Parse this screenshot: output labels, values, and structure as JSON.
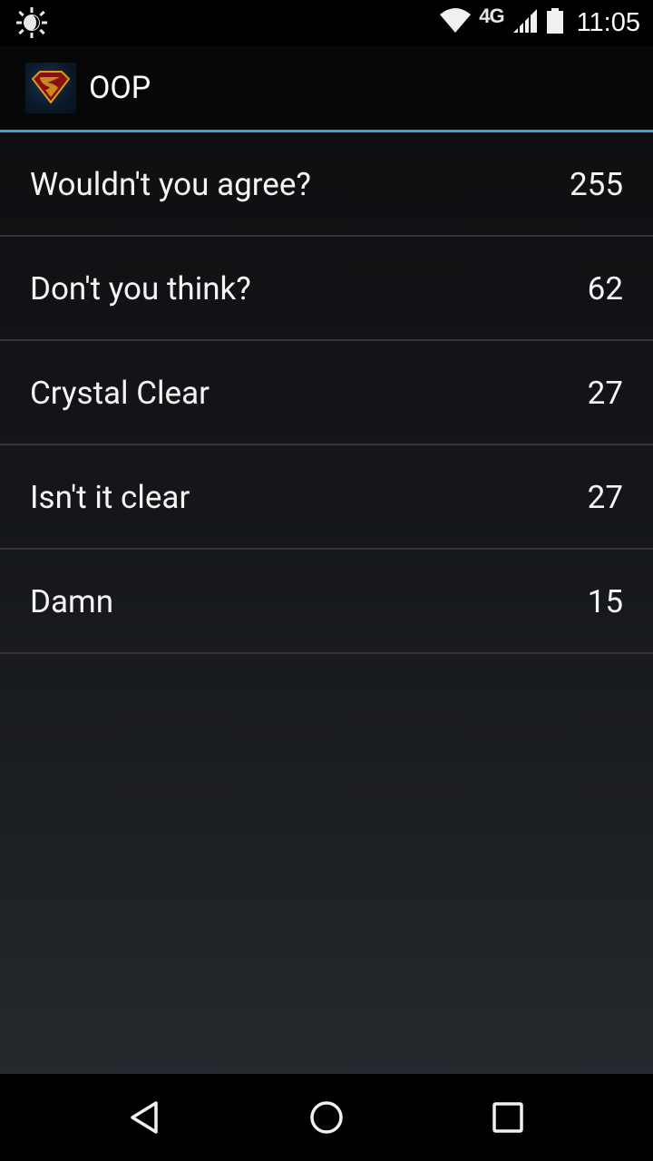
{
  "status_bar": {
    "network": "4G",
    "time": "11:05",
    "icons": [
      "brightness-icon",
      "wifi-icon",
      "signal-icon",
      "battery-icon"
    ]
  },
  "action_bar": {
    "title": "OOP",
    "icon": "superman-logo-icon",
    "accent_color": "#3c9fd2"
  },
  "list": {
    "items": [
      {
        "label": "Wouldn't you agree?",
        "count": "255"
      },
      {
        "label": "Don't you think?",
        "count": "62"
      },
      {
        "label": "Crystal Clear",
        "count": "27"
      },
      {
        "label": "Isn't it clear",
        "count": "27"
      },
      {
        "label": "Damn",
        "count": "15"
      }
    ]
  },
  "nav_bar": {
    "buttons": [
      "back-icon",
      "home-icon",
      "recents-icon"
    ]
  }
}
